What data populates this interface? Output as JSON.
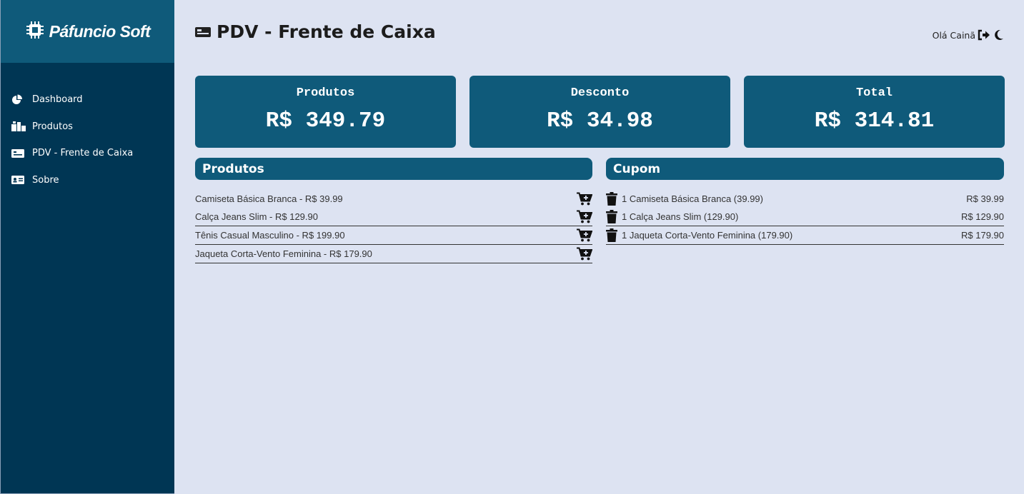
{
  "brand": {
    "name": "Páfuncio Soft"
  },
  "sidebar": {
    "items": [
      {
        "label": "Dashboard",
        "icon": "pie-chart-icon"
      },
      {
        "label": "Produtos",
        "icon": "boxes-icon"
      },
      {
        "label": "PDV - Frente de Caixa",
        "icon": "cash-register-icon"
      },
      {
        "label": "Sobre",
        "icon": "id-card-icon"
      }
    ]
  },
  "header": {
    "title": "PDV - Frente de Caixa",
    "greeting": "Olá Cainã",
    "icons": [
      "money-bill-icon",
      "logout-icon",
      "moon-icon"
    ]
  },
  "summary": {
    "produtos": {
      "label": "Produtos",
      "value": "R$ 349.79"
    },
    "desconto": {
      "label": "Desconto",
      "value": "R$ 34.98"
    },
    "total": {
      "label": "Total",
      "value": "R$ 314.81"
    }
  },
  "produtos_panel": {
    "title": "Produtos",
    "items": [
      {
        "text": "Camiseta Básica Branca - R$ 39.99"
      },
      {
        "text": "Calça Jeans Slim - R$ 129.90"
      },
      {
        "text": "Tênis Casual Masculino - R$ 199.90"
      },
      {
        "text": "Jaqueta Corta-Vento Feminina - R$ 179.90"
      }
    ]
  },
  "cupom_panel": {
    "title": "Cupom",
    "items": [
      {
        "text": "1 Camiseta Básica Branca (39.99)",
        "price": "R$ 39.99"
      },
      {
        "text": "1 Calça Jeans Slim (129.90)",
        "price": "R$ 129.90"
      },
      {
        "text": "1 Jaqueta Corta-Vento Feminina (179.90)",
        "price": "R$ 179.90"
      }
    ]
  },
  "colors": {
    "sidebar_bg": "#003654",
    "brand_bg": "#0f5a7a",
    "card_bg": "#0f5a7a",
    "page_bg": "#dde3f2"
  }
}
